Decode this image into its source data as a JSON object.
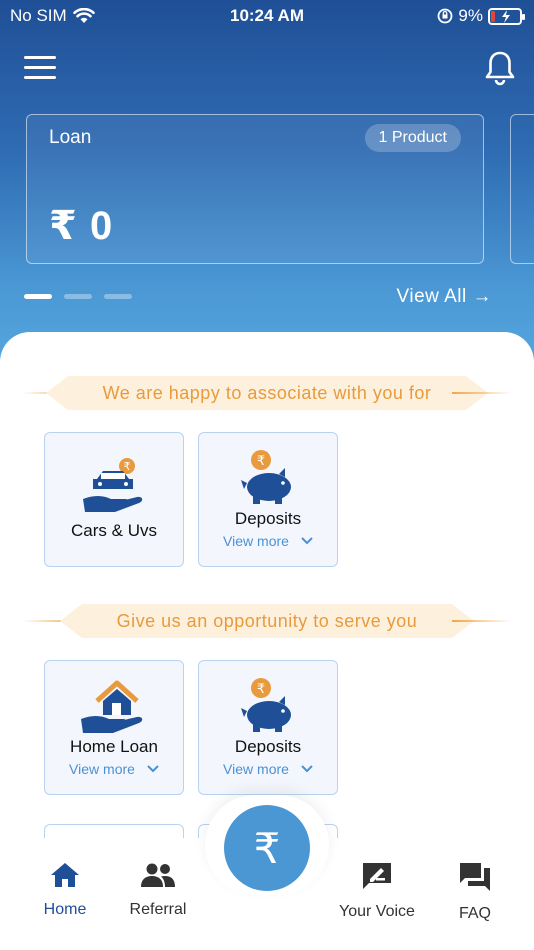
{
  "status_bar": {
    "carrier": "No SIM",
    "time": "10:24 AM",
    "battery": "9%"
  },
  "colors": {
    "primary": "#1f4f96",
    "accent_orange": "#e89a3c",
    "link_blue": "#4a90d4",
    "fab_blue": "#4a97d4"
  },
  "header": {
    "menu_icon": "hamburger-icon",
    "bell_icon": "bell-icon"
  },
  "loan_card": {
    "title": "Loan",
    "badge": "1 Product",
    "amount": "₹ 0"
  },
  "carousel": {
    "view_all": "View All →"
  },
  "section_associate": {
    "heading": "We are happy to associate with you for",
    "tiles": [
      {
        "label": "Cars & Uvs",
        "icon": "car-in-hand-icon"
      },
      {
        "label": "Deposits",
        "more": "View more",
        "icon": "piggy-bank-icon"
      }
    ]
  },
  "section_serve": {
    "heading": "Give us an opportunity to serve you",
    "tiles": [
      {
        "label": "Home Loan",
        "more": "View more",
        "icon": "house-in-hand-icon"
      },
      {
        "label": "Deposits",
        "more": "View more",
        "icon": "piggy-bank-icon"
      }
    ]
  },
  "bottom_nav": {
    "items": [
      {
        "label": "Home",
        "icon": "home-icon"
      },
      {
        "label": "Referral",
        "icon": "people-icon"
      },
      {
        "label": "Your Voice",
        "icon": "feedback-icon"
      },
      {
        "label": "FAQ",
        "icon": "chat-icon"
      }
    ],
    "fab": "₹"
  }
}
